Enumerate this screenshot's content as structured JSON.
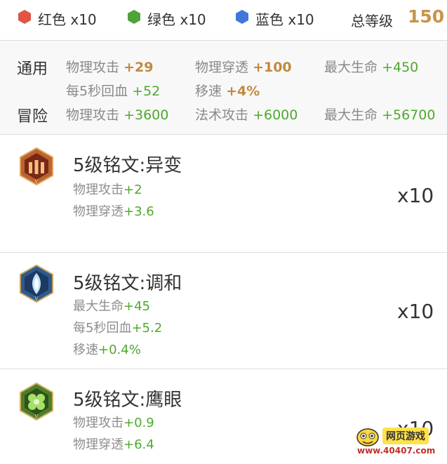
{
  "colors": {
    "red_gem": "#e05545",
    "green_gem": "#4ea33a",
    "blue_gem": "#3f78d6",
    "accent_gold": "#c08a3e",
    "stat_green": "#4fa82f"
  },
  "gems": [
    {
      "icon": "red-gem-icon",
      "label": "红色 x10"
    },
    {
      "icon": "green-gem-icon",
      "label": "绿色 x10"
    },
    {
      "icon": "blue-gem-icon",
      "label": "蓝色 x10"
    }
  ],
  "total_level": {
    "label": "总等级",
    "value": "150"
  },
  "summary": {
    "general": {
      "label": "通用",
      "stats": [
        {
          "name": "物理攻击",
          "value": "+29"
        },
        {
          "name": "物理穿透",
          "value": "+100"
        },
        {
          "name": "最大生命",
          "value": "+450"
        },
        {
          "name": "每5秒回血",
          "value": "+52"
        },
        {
          "name": "移速",
          "value": "+4%"
        }
      ]
    },
    "adventure": {
      "label": "冒险",
      "stats": [
        {
          "name": "物理攻击",
          "value": "+3600"
        },
        {
          "name": "法术攻击",
          "value": "+6000"
        },
        {
          "name": "最大生命",
          "value": "+56700"
        }
      ]
    }
  },
  "inscriptions": [
    {
      "icon": "red-inscription-icon",
      "title": "5级铭文:异变",
      "stats": [
        {
          "name": "物理攻击",
          "value": "+2"
        },
        {
          "name": "物理穿透",
          "value": "+3.6"
        }
      ],
      "count": "x10"
    },
    {
      "icon": "blue-inscription-icon",
      "title": "5级铭文:调和",
      "stats": [
        {
          "name": "最大生命",
          "value": "+45"
        },
        {
          "name": "每5秒回血",
          "value": "+5.2"
        },
        {
          "name": "移速",
          "value": "+0.4%"
        }
      ],
      "count": "x10"
    },
    {
      "icon": "green-inscription-icon",
      "title": "5级铭文:鹰眼",
      "stats": [
        {
          "name": "物理攻击",
          "value": "+0.9"
        },
        {
          "name": "物理穿透",
          "value": "+6.4"
        }
      ],
      "count": "x10"
    }
  ],
  "watermark": {
    "text": "网页游戏",
    "url": "www.40407.com"
  }
}
